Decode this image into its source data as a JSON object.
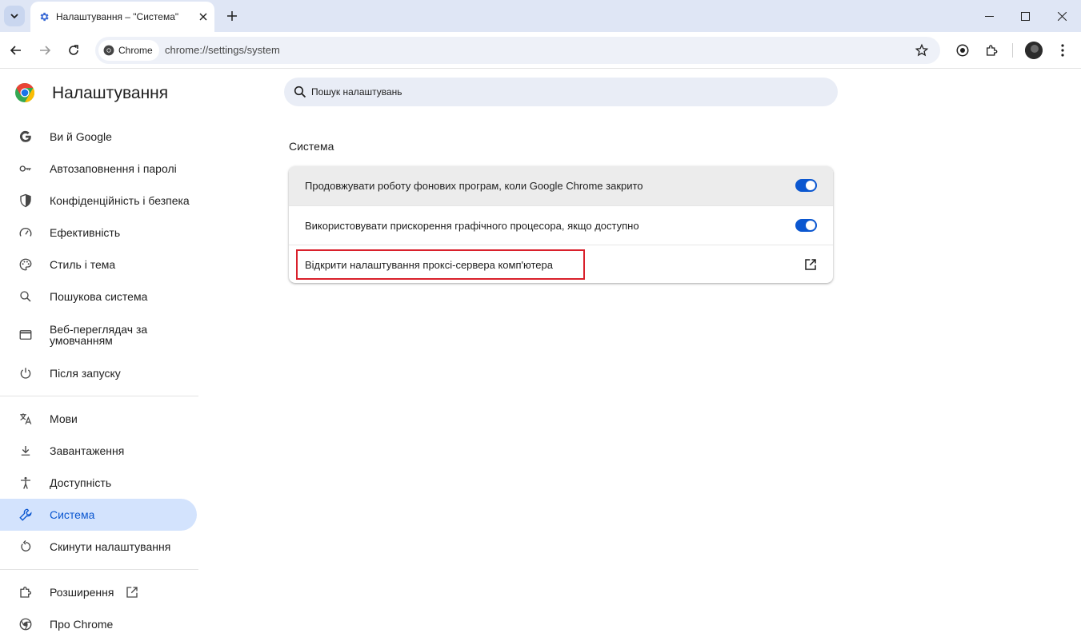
{
  "browser": {
    "tab_title": "Налаштування – \"Система\"",
    "chip_label": "Chrome",
    "url": "chrome://settings/system"
  },
  "header": {
    "title": "Налаштування",
    "search_placeholder": "Пошук налаштувань"
  },
  "sidebar": {
    "items": [
      {
        "label": "Ви й Google",
        "icon": "google-icon"
      },
      {
        "label": "Автозаповнення і паролі",
        "icon": "key-icon"
      },
      {
        "label": "Конфіденційність і безпека",
        "icon": "shield-icon"
      },
      {
        "label": "Ефективність",
        "icon": "speedometer-icon"
      },
      {
        "label": "Стиль і тема",
        "icon": "palette-icon"
      },
      {
        "label": "Пошукова система",
        "icon": "search-icon"
      },
      {
        "label": "Веб-переглядач за умовчанням",
        "icon": "browser-window-icon"
      },
      {
        "label": "Після запуску",
        "icon": "power-icon"
      },
      {
        "label": "Мови",
        "icon": "translate-icon"
      },
      {
        "label": "Завантаження",
        "icon": "download-icon"
      },
      {
        "label": "Доступність",
        "icon": "accessibility-icon"
      },
      {
        "label": "Система",
        "icon": "wrench-icon",
        "active": true
      },
      {
        "label": "Скинути налаштування",
        "icon": "reset-icon"
      },
      {
        "label": "Розширення",
        "icon": "puzzle-icon"
      },
      {
        "label": "Про Chrome",
        "icon": "chrome-icon"
      }
    ]
  },
  "main": {
    "section_title": "Система",
    "rows": [
      {
        "label": "Продовжувати роботу фонових програм, коли Google Chrome закрито",
        "toggle": true
      },
      {
        "label": "Використовувати прискорення графічного процесора, якщо доступно",
        "toggle": true
      },
      {
        "label": "Відкрити налаштування проксі-сервера комп'ютера",
        "external": true
      }
    ]
  },
  "colors": {
    "accent": "#0b57d0",
    "active_bg": "#d3e3fd",
    "highlight_border": "#d9202b",
    "tabstrip_bg": "#dfe6f5"
  }
}
